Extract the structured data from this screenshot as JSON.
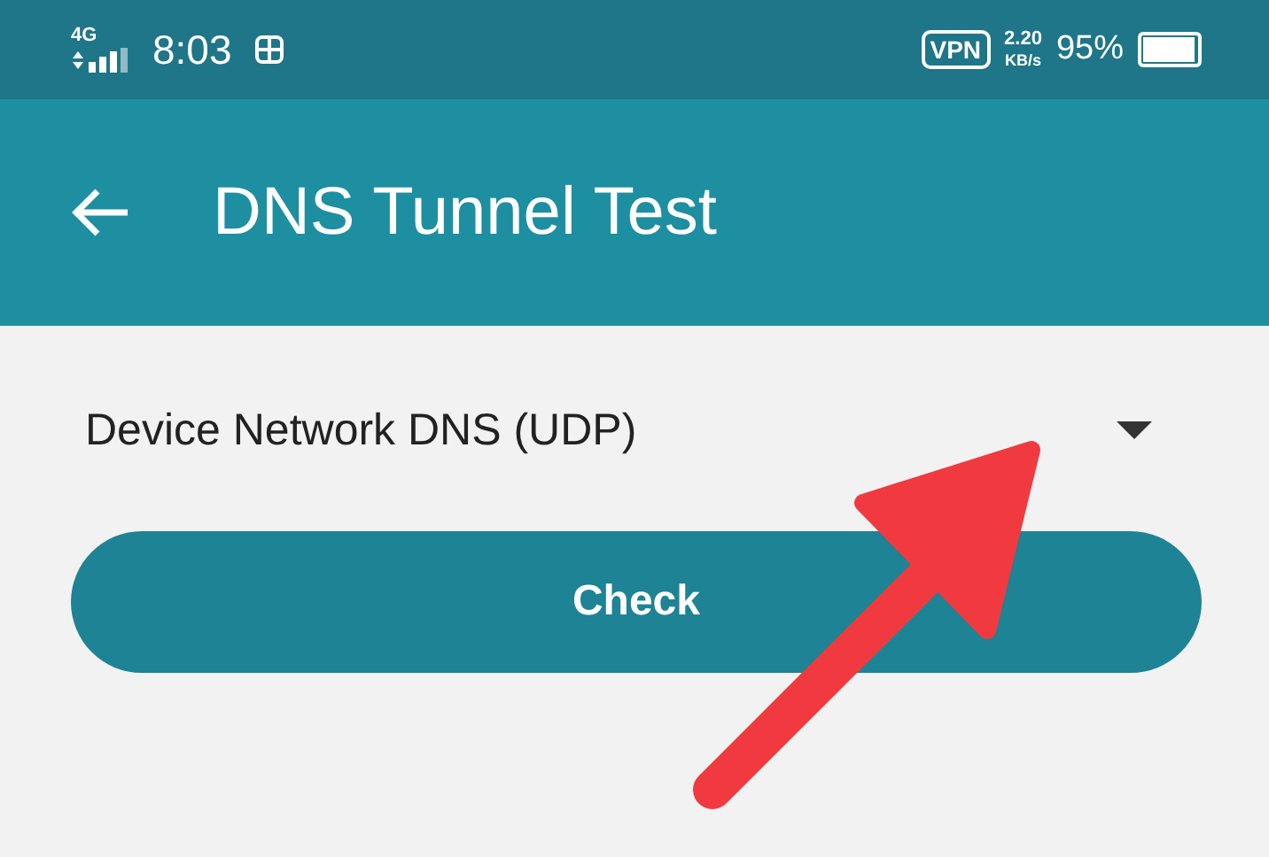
{
  "status_bar": {
    "network": "4G",
    "time": "8:03",
    "vpn": "VPN",
    "speed_value": "2.20",
    "speed_unit": "KB/s",
    "battery": "95%"
  },
  "app_bar": {
    "title": "DNS Tunnel Test"
  },
  "dropdown": {
    "value": "Device Network DNS (UDP)"
  },
  "buttons": [
    "Check"
  ]
}
